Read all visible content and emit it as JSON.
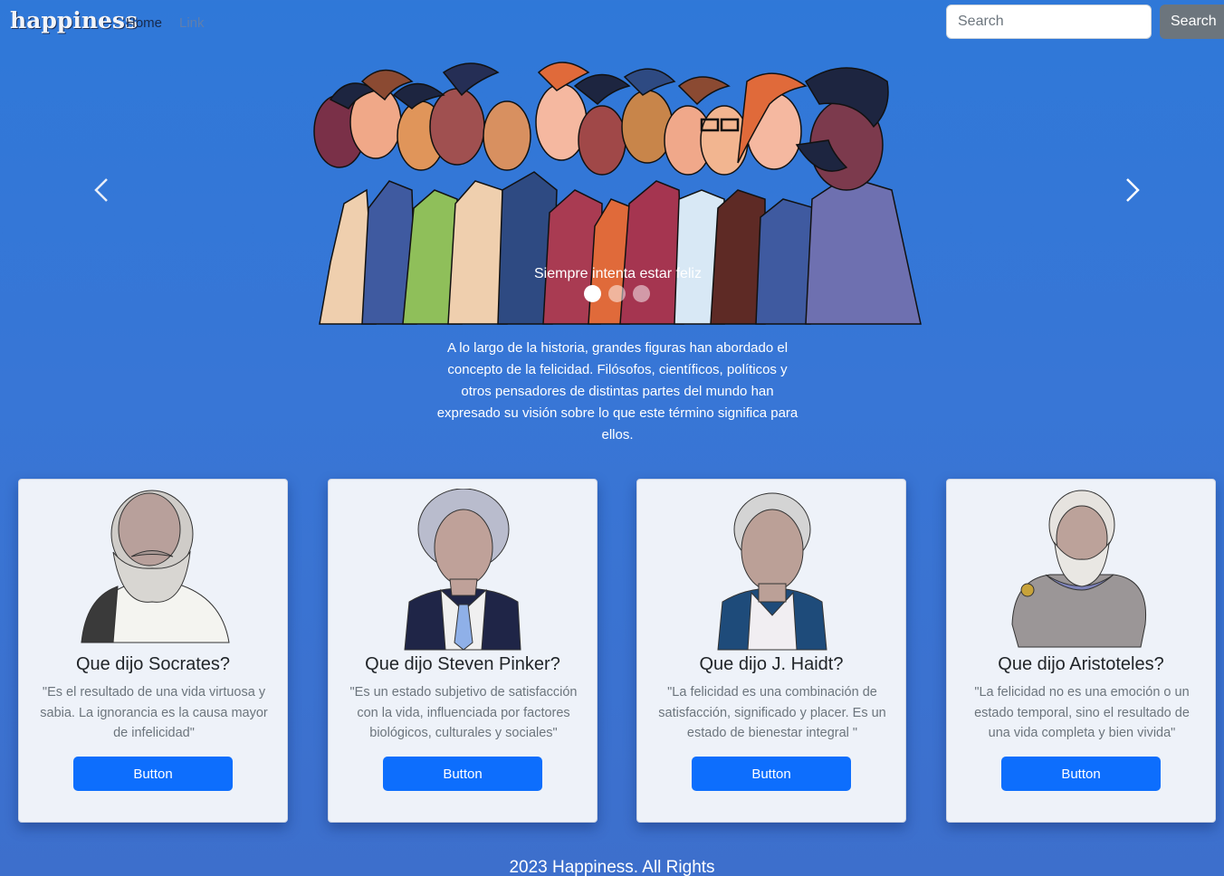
{
  "navbar": {
    "brand": "happiness",
    "home_label": "Home",
    "link_label": "Link",
    "search_placeholder": "Search",
    "search_button": "Search"
  },
  "carousel": {
    "caption": "Siempre intenta estar feliz",
    "slide_count": 3,
    "active_index": 0
  },
  "intro_text": "A lo largo de la historia, grandes figuras han abordado el concepto de la felicidad. Filósofos, científicos, políticos y otros pensadores de distintas partes del mundo han expresado su visión sobre lo que este término significa para ellos.",
  "cards": [
    {
      "title": "Que dijo Socrates?",
      "text": "\"Es el resultado de una vida virtuosa y sabia. La ignorancia es la causa mayor de infelicidad\"",
      "button": "Button"
    },
    {
      "title": "Que dijo Steven Pinker?",
      "text": "\"Es un estado subjetivo de satisfacción con la vida, influenciada por factores biológicos, culturales y sociales\"",
      "button": "Button"
    },
    {
      "title": "Que dijo J. Haidt?",
      "text": "\"La felicidad es una combinación de satisfacción, significado y placer. Es un estado de bienestar integral \"",
      "button": "Button"
    },
    {
      "title": "Que dijo Aristoteles?",
      "text": "\"La felicidad no es una emoción o un estado temporal, sino el resultado de una vida completa y bien vivida\"",
      "button": "Button"
    }
  ],
  "footer": "2023 Happiness. All Rights",
  "colors": {
    "background": "#3376d6",
    "primary_button": "#0d6efd",
    "secondary_button": "#6c757d"
  }
}
